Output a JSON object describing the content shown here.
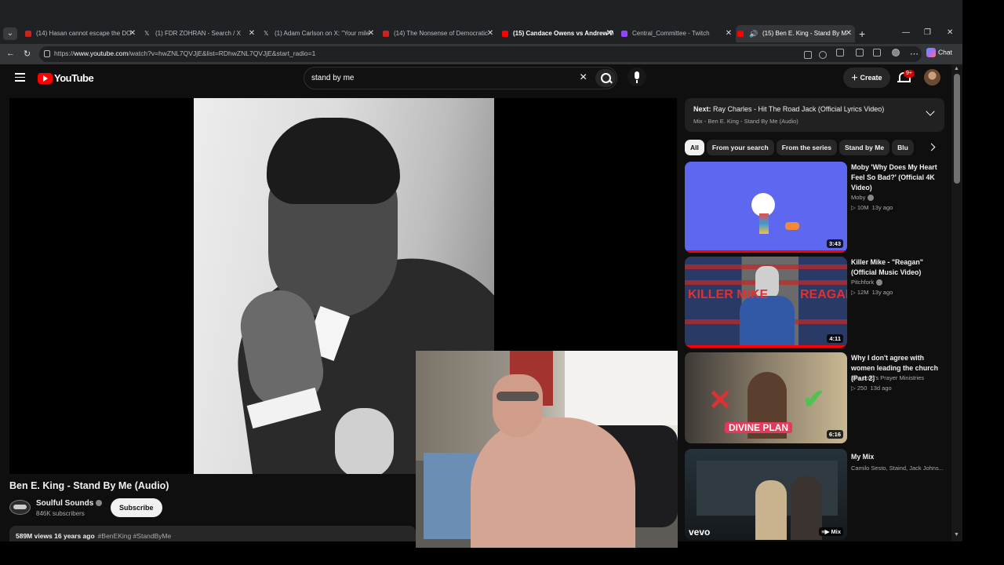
{
  "browser": {
    "tabs": [
      {
        "label": "(14) Hasan cannot escape the DO",
        "active": false
      },
      {
        "label": "(1) FDR ZOHRAN - Search / X",
        "active": false
      },
      {
        "label": "(1) Adam Carlson on X: \"Your mile",
        "active": false
      },
      {
        "label": "(14) The Nonsense of Democratic",
        "active": false
      },
      {
        "label": "(15) Candace Owens vs Andrew W",
        "active": false
      },
      {
        "label": "Central_Committee - Twitch",
        "active": false
      },
      {
        "label": "(15) Ben E. King - Stand By M",
        "active": true
      }
    ],
    "url_prefix": "https://",
    "url_host": "www.youtube.com",
    "url_rest": "/watch?v=hwZNL7QVJjE&list=RDhwZNL7QVJjE&start_radio=1",
    "chat_label": "Chat"
  },
  "header": {
    "logo_text": "YouTube",
    "search_query": "stand by me",
    "create_label": "Create",
    "notif_count": "9+"
  },
  "video": {
    "title": "Ben E. King - Stand By Me (Audio)",
    "channel": "Soulful Sounds",
    "subscribers": "846K subscribers",
    "subscribe_label": "Subscribe",
    "views": "589M views",
    "age": "16 years ago",
    "tags": "#BenEKing #StandByMe"
  },
  "up_next": {
    "label": "Next:",
    "title": "Ray Charles - Hit The Road Jack (Official Lyrics Video)",
    "subtitle": "Mix - Ben E. King - Stand By Me (Audio)"
  },
  "chips": [
    "All",
    "From your search",
    "From the series",
    "Stand by Me",
    "Blu"
  ],
  "related": [
    {
      "title": "Moby 'Why Does My Heart Feel So Bad?' (Official 4K Video)",
      "channel": "Moby",
      "views": "10M",
      "age": "13y ago",
      "duration": "3:43"
    },
    {
      "title": "Killer Mike - \"Reagan\" (Official Music Video)",
      "channel": "Pitchfork",
      "views": "12M",
      "age": "13y ago",
      "duration": "4:11"
    },
    {
      "title": "Why I don't agree with women leading the church (Part 2)",
      "channel": "The Lord's Prayer Ministries",
      "views": "250",
      "age": "13d ago",
      "duration": "6:16",
      "thumb_text": "DIVINE PLAN"
    },
    {
      "title": "My Mix",
      "channel": "Camilo Sesto, Staind, Jack Johns...",
      "thumb_brand": "vevo",
      "badge": "Mix"
    }
  ],
  "thumb2_words": [
    "KILLER MIKE",
    "REAGAN"
  ]
}
